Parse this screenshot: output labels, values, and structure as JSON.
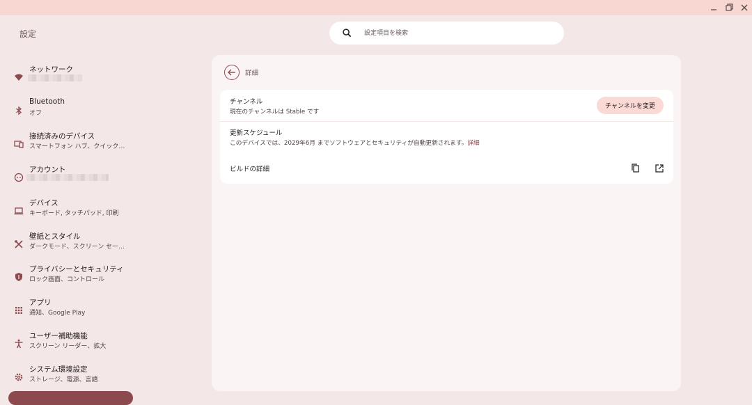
{
  "app": {
    "title": "設定"
  },
  "search": {
    "placeholder": "設定項目を検索"
  },
  "window_controls": [
    "minimize-icon",
    "restore-icon",
    "close-icon"
  ],
  "sidebar": {
    "items": [
      {
        "label": "ネットワーク",
        "sublabel": "",
        "icon": "wifi-icon"
      },
      {
        "label": "Bluetooth",
        "sublabel": "オフ",
        "icon": "bluetooth-icon"
      },
      {
        "label": "接続済みのデバイス",
        "sublabel": "スマートフォン ハブ、クイック…",
        "icon": "connected-devices-icon"
      },
      {
        "label": "アカウント",
        "sublabel": "",
        "icon": "account-icon"
      },
      {
        "label": "デバイス",
        "sublabel": "キーボード, タッチパッド, 印刷",
        "icon": "laptop-icon"
      },
      {
        "label": "壁紙とスタイル",
        "sublabel": "ダークモード、スクリーン セー…",
        "icon": "palette-icon"
      },
      {
        "label": "プライバシーとセキュリティ",
        "sublabel": "ロック画面、コントロール",
        "icon": "shield-icon"
      },
      {
        "label": "アプリ",
        "sublabel": "通知、Google Play",
        "icon": "apps-grid-icon"
      },
      {
        "label": "ユーザー補助機能",
        "sublabel": "スクリーン リーダー、拡大",
        "icon": "accessibility-icon"
      },
      {
        "label": "システム環境設定",
        "sublabel": "ストレージ、電源、言語",
        "icon": "gear-icon"
      }
    ]
  },
  "main": {
    "title": "詳細",
    "channel": {
      "title": "チャンネル",
      "subtitle": "現在のチャンネルは Stable です",
      "button_label": "チャンネルを変更"
    },
    "schedule": {
      "title": "更新スケジュール",
      "subtitle": "このデバイスでは、2029年6月 までソフトウェアとセキュリティが自動更新されます。",
      "link_label": "詳細"
    },
    "build": {
      "title": "ビルドの詳細"
    }
  },
  "colors": {
    "accent": "#8c4a4f",
    "background": "#f3e7e7",
    "titlebar": "#f8d7d3",
    "button": "#fbd9d5"
  }
}
